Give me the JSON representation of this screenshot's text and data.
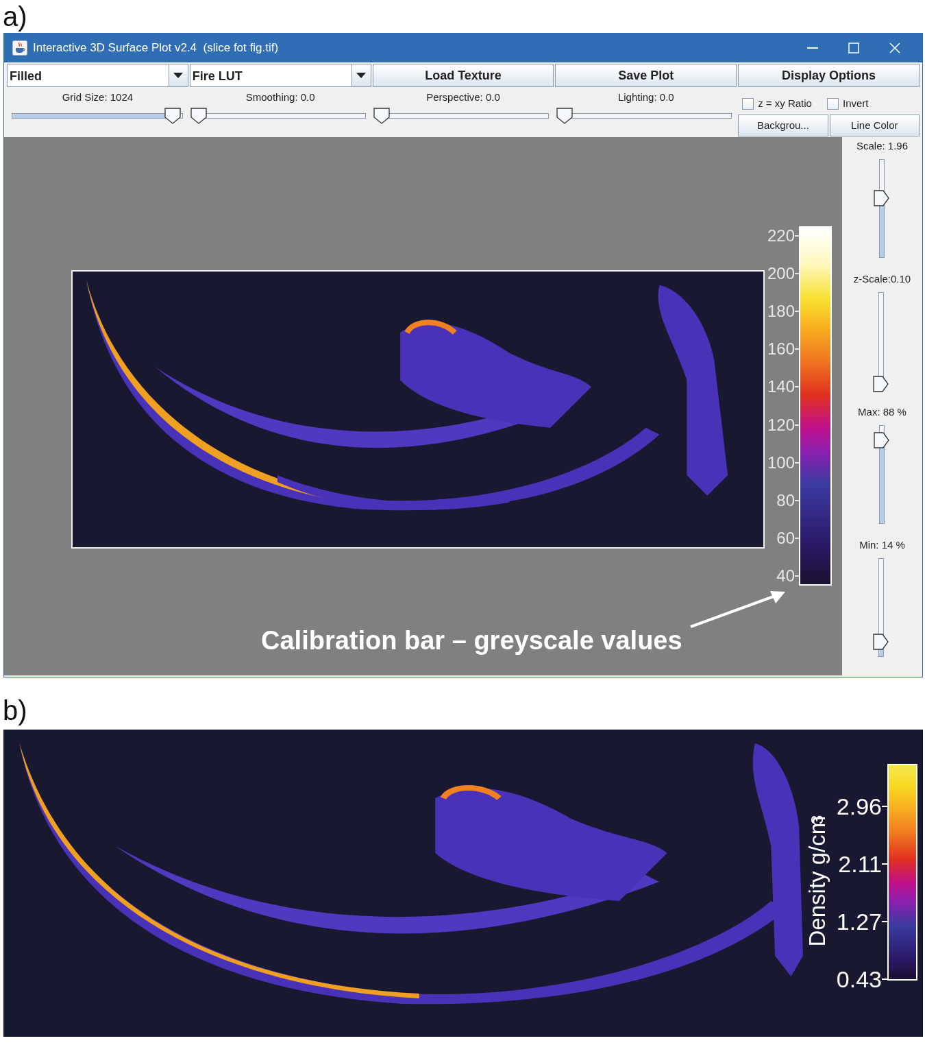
{
  "panel_a": {
    "label": "a)",
    "window": {
      "title": "Interactive 3D Surface Plot v2.4  (slice fot fig.tif)",
      "combos": [
        {
          "value": "Filled"
        },
        {
          "value": "Fire LUT"
        }
      ],
      "buttons": [
        "Load Texture",
        "Save Plot",
        "Display Options"
      ],
      "sliders": [
        {
          "label": "Grid Size: 1024",
          "level": 0.96
        },
        {
          "label": "Smoothing: 0.0",
          "level": 0
        },
        {
          "label": "Perspective: 0.0",
          "level": 0
        },
        {
          "label": "Lighting: 0.0",
          "level": 0
        }
      ],
      "checkboxes": [
        {
          "label": "z = xy Ratio",
          "checked": false
        },
        {
          "label": "Invert",
          "checked": false
        }
      ],
      "small_buttons": [
        "Backgrou...",
        "Line Color"
      ],
      "side_sliders": [
        {
          "label": "Scale: 1.96",
          "level": 0.61
        },
        {
          "label": "z-Scale:0.10",
          "level": 0.03
        },
        {
          "label": "Max: 88 %",
          "level": 0.88
        },
        {
          "label": "Min: 14 %",
          "level": 0.12
        }
      ],
      "calibration_bar": {
        "ticks": [
          "220",
          "200",
          "180",
          "160",
          "140",
          "120",
          "100",
          "80",
          "60",
          "40"
        ]
      },
      "annotation": "Calibration bar – greyscale values"
    }
  },
  "panel_b": {
    "label": "b)",
    "colorbar": {
      "title": "Density g/cm$^{3}$",
      "ticks": [
        "2.96",
        "2.11",
        "1.27",
        "0.43"
      ]
    }
  }
}
